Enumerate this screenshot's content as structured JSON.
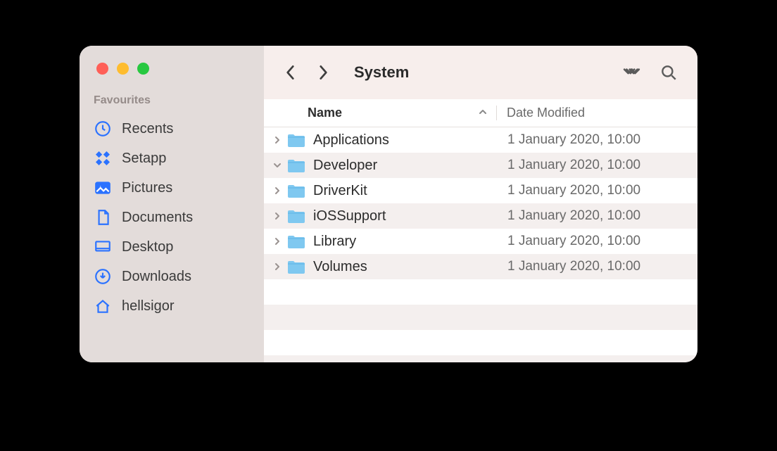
{
  "sidebar": {
    "heading": "Favourites",
    "items": [
      {
        "label": "Recents",
        "icon": "clock"
      },
      {
        "label": "Setapp",
        "icon": "setapp"
      },
      {
        "label": "Pictures",
        "icon": "pictures"
      },
      {
        "label": "Documents",
        "icon": "documents"
      },
      {
        "label": "Desktop",
        "icon": "desktop"
      },
      {
        "label": "Downloads",
        "icon": "downloads"
      },
      {
        "label": "hellsigor",
        "icon": "home"
      }
    ]
  },
  "toolbar": {
    "title": "System"
  },
  "columns": {
    "name": "Name",
    "date": "Date Modified"
  },
  "files": [
    {
      "name": "Applications",
      "date": "1 January 2020, 10:00",
      "expanded": false
    },
    {
      "name": "Developer",
      "date": "1 January 2020, 10:00",
      "expanded": true
    },
    {
      "name": "DriverKit",
      "date": "1 January 2020, 10:00",
      "expanded": false
    },
    {
      "name": "iOSSupport",
      "date": "1 January 2020, 10:00",
      "expanded": false
    },
    {
      "name": "Library",
      "date": "1 January 2020, 10:00",
      "expanded": false
    },
    {
      "name": "Volumes",
      "date": "1 January 2020, 10:00",
      "expanded": false
    }
  ]
}
